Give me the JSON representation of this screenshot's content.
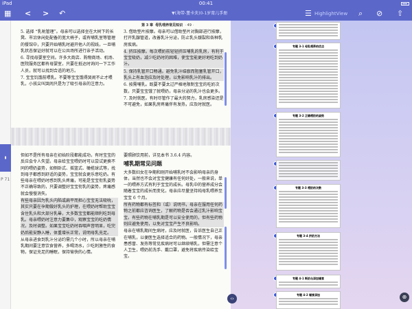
{
  "status": {
    "device": "iPad",
    "time": "00:41"
  },
  "toolbar": {
    "grid": "▦",
    "back": "<",
    "forward": ">",
    "undo": "↶",
    "doc_title": "▼(海带-董卡夫)0-1岁育儿手册",
    "list": "☰",
    "highlight_view": "HighlightView",
    "search": "⌕",
    "tag": "⊘",
    "share": "⇧"
  },
  "sidebar": {
    "page_label": "P 71"
  },
  "page": {
    "header_section": "第 3 章",
    "header_title": "母乳喂养常见知识",
    "header_page": "· 49 ·",
    "left_top": [
      "5. 选择 “乳吮管理”。母亲可以选择坐在大树下的长凳、市沿休闲处配备的宽大椅子，或有哺乳室等管理的餐馆中，只要开始哺乳时避开他人的视线，一旦哺乳状态保证好就可以在公共场所进行亲子活动。",
      "6. 寻找母婴室空间。许多大商店、购物商场、机场、医院服务区都有母婴室，只要在抵达时询问一下工作人员，就可以找到合适的地方。",
      "7. 宝宝饥饿前喂乳。不要等宝宝饿得哭闹不止才喂乳，小孩尖叫哭闹只是为了吸引母亲的注意力。"
    ],
    "right_top": [
      "3. 借助垫片按摩。母亲可以借助垫片对胸部进行按摩，打开乳腺管道，改善乳汁分泌，防止乳头皲裂和各种乳房疾病。",
      "4. 挤压按摩。每次喂奶前轻轻挤压哺乳的乳房，有利于宝宝吸奶，减少吃奶时的困难，使宝宝能更好地吃到奶汁。",
      "5. 保持乳管开口畅通。避免乳汁结痂而阻塞乳管开口，乳头上有血泡应及时处理，以免影响乳汁的排出。",
      "6. 按需哺乳。既要不要太过严格地限制宝宝的吃奶次数，只要宝宝饿了就喂奶，母亲分泌的乳汁也会更多。",
      "7. 及时就医。有时尽管作了最大的努力，乳房感染还是不可避免，如果乳房疼痛伴有发热，应及时就医。"
    ],
    "left_bottom": [
      "但如不是所有母亲在初始阶段都能成功，有时宝宝的反应会令人失望。母亲给宝宝喂奶时可以尝试更换不同的喂奶姿势，如侧卧式、摇篮式、橄榄球式等，找到母子都感到舒适的姿势，宝宝就会更乐意吃奶。有些母亲在喂奶时感到乳头疼痛，可能是宝宝衔乳姿势不正确导致的，只要调整好宝宝衔乳的姿势，疼痛感就会慢慢消失。",
      "有些母亲因为乳头内陷或扁平而担心宝宝无法吸吮，其实只要在孕期做好乳头的护理，在喂奶时帮助宝宝含住乳头和大部分乳晕，大多数宝宝都能顺利吃到母乳。母亲喂奶时注意力要集中，观察宝宝的吃奶情况，及时调整。如果宝宝吃奶时吞咽声音明显，吃完奶后能安静入睡，体重增长正常，说明母乳充足。",
      "从母亲进食到乳汁分泌约需几个小时，所以母亲在哺乳期间要注意饮食营养，多喝汤水，少吃刺激性的食物，保证充足的睡眠，保持愉快的心情。"
    ],
    "right_bottom_lead": "要照顾饮用前，详见本书 3.6.4 内容。",
    "right_bottom_heading": "哺乳期常见问题",
    "right_bottom": [
      "大多数妇女在孕期和刚开始哺乳时不会影响母亲的身体，当然也不会对宝宝健康有任何好处，一般来说，单一的喂养方式有利于宝宝的成长。母乳中的营养成分会随着宝宝的成长而变化，母亲应尽量坚持纯母乳喂养至宝宝 6 个月。",
      "所有药物都有标签和（或）说明书，母亲在服用任何药物之前都应咨询医生，了解药物是否会通过乳汁影响宝宝。有些药物在哺乳期是可以安全使用的，但有些药物则应避免使用，以免对宝宝产生不良影响。",
      "母亲在哺乳期间生病时，应及时就医，告诉医生自己正在哺乳，以便医生选择适合的药物。一般情况下，母亲患感冒、发热等常见疾病时可以继续哺乳，但需注意个人卫生，喂奶前洗手、戴口罩，避免将疾病传染给宝宝。"
    ]
  },
  "annotations": {
    "cards": [
      {
        "title": "专题 3-1  母乳喂养的优点"
      },
      {
        "title": "专题 3-2  正确喂奶的姿势"
      },
      {
        "title": ""
      },
      {
        "title": "专题 3-3  喂奶的次数"
      },
      {
        "title": "专题 3-4  挤奶方法"
      },
      {
        "title": "专题 4-1  断奶与添加辅食"
      },
      {
        "title": "专题 4-2  辅食添加"
      }
    ]
  },
  "controls": {
    "page_scroll": "‹›",
    "zoom": "⊕"
  },
  "colors": {
    "accent": "#5b67c9",
    "pin": "#3b58d6",
    "margin_bar": "#7d8ee8"
  }
}
